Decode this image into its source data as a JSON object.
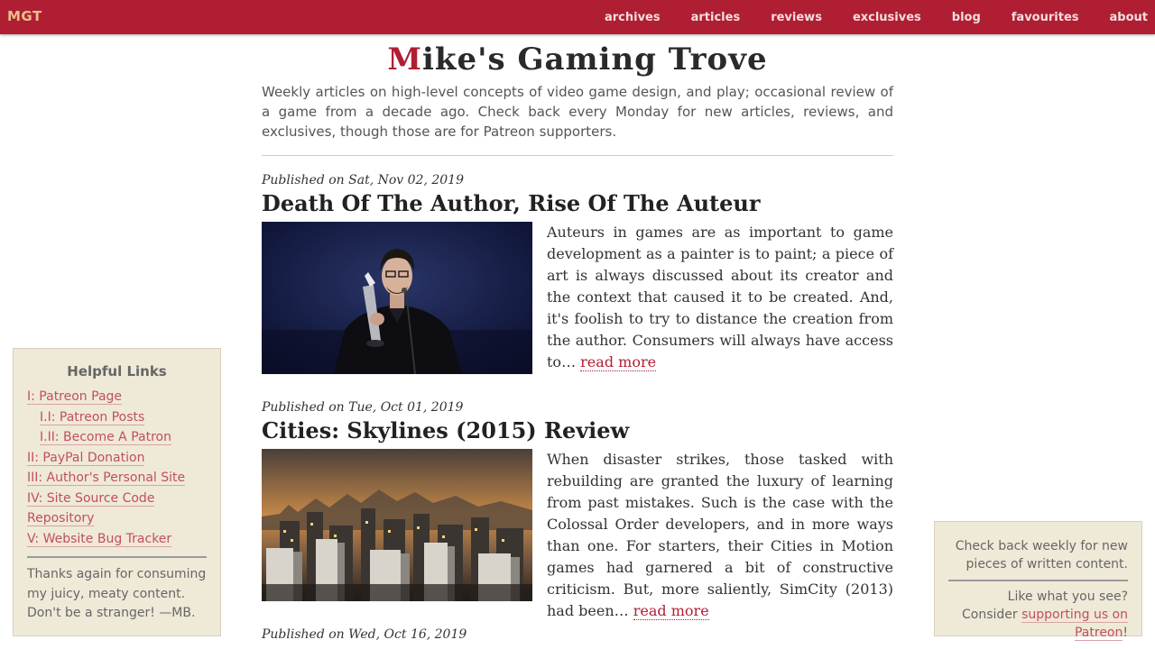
{
  "nav": {
    "brand": "MGT",
    "items": [
      "archives",
      "articles",
      "reviews",
      "exclusives",
      "blog",
      "favourites",
      "about"
    ]
  },
  "header": {
    "title_first": "M",
    "title_rest": "ike's Gaming Trove",
    "tagline": "Weekly articles on high-level concepts of video game design, and play; occasional review of a game from a decade ago. Check back every Monday for new articles, reviews, and exclusives, though those are for Patreon supporters."
  },
  "posts": [
    {
      "date": "Published on Sat, Nov 02, 2019",
      "title": "Death Of The Author, Rise Of The Auteur",
      "excerpt": "Auteurs in games are as important to game development as a painter is to paint; a piece of art is always discussed about its creator and the context that caused it to be created. And, it's foolish to try to distance the creation from the author. Consumers will always have access to…",
      "read_more": "read more"
    },
    {
      "date": "Published on Tue, Oct 01, 2019",
      "title": "Cities: Skylines (2015) Review",
      "excerpt": "When disaster strikes, those tasked with rebuilding are granted the luxury of learning from past mistakes. Such is the case with the Colossal Order developers, and in more ways than one. For starters, their Cities in Motion games had garnered a bit of constructive criticism. But, more saliently, SimCity (2013) had been…",
      "read_more": "read more"
    },
    {
      "date": "Published on Wed, Oct 16, 2019"
    }
  ],
  "links_panel": {
    "heading": "Helpful Links",
    "links": [
      "I: Patreon Page",
      "I.I: Patreon Posts",
      "I.II: Become A Patron",
      "II: PayPal Donation",
      "III: Author's Personal Site",
      "IV: Site Source Code Repository",
      "V: Website Bug Tracker"
    ],
    "thanks": "Thanks again for consuming my juicy, meaty content. Don't be a stranger! —MB."
  },
  "right_panel": {
    "check_back": "Check back weekly for new pieces of written content.",
    "consider": "Like what you see? Consider ",
    "patreon_link": "supporting us on Patreon",
    "exclaim": "!"
  },
  "colors": {
    "accent": "#b01e33",
    "panel_bg": "#efe9d8",
    "brand": "#e6c08a"
  }
}
